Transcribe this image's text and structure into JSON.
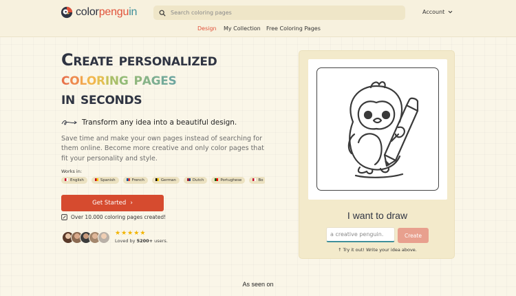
{
  "header": {
    "logo": {
      "part1": "color",
      "part2": "pengu",
      "part3": "in"
    },
    "search": {
      "placeholder": "Search coloring pages"
    },
    "account_label": "Account",
    "nav": [
      {
        "label": "Design",
        "active": true
      },
      {
        "label": "My Collection",
        "active": false
      },
      {
        "label": "Free Coloring Pages",
        "active": false
      }
    ]
  },
  "hero": {
    "title_line1": "Create personalized",
    "title_line2_letters": [
      "c",
      "o",
      "l",
      "o",
      "r",
      "i",
      "n",
      "g",
      " ",
      "p",
      "a",
      "g",
      "e",
      "s"
    ],
    "title_line3": "in seconds",
    "tagline": "Transform any idea into a beautiful design.",
    "description": "Save time and make your own pages instead of searching for them online. Become more creative and only color pages that fit your personality and style.",
    "works_in_label": "Works in:",
    "languages": [
      "English",
      "Spanish",
      "French",
      "German",
      "Dutch",
      "Portughese",
      "Bo"
    ],
    "cta_label": "Get Started",
    "pages_created": "Over 10.000 coloring pages created!",
    "rating_stars": 5,
    "loved_prefix": "Loved by ",
    "loved_count": "5200+",
    "loved_suffix": " users."
  },
  "generator": {
    "heading": "I want to draw",
    "input_value": "a creative penguin.",
    "create_label": "Create",
    "hint": "Try it out! Write your idea above."
  },
  "footer": {
    "as_seen_on": "As seen on"
  },
  "colors": {
    "accent": "#d64b2f",
    "teal": "#3f8f9a",
    "background": "#faf6e8",
    "gradient_letters": [
      "#e8734a",
      "#ee8a4e",
      "#f2a64f",
      "#f2b64d",
      "#e5bf52",
      "#c6c25a",
      "#a9bf69",
      "#93bb77",
      "#ffffff",
      "#8fb67e",
      "#86b388",
      "#7cae91",
      "#74aa99",
      "#6ea69f"
    ]
  }
}
